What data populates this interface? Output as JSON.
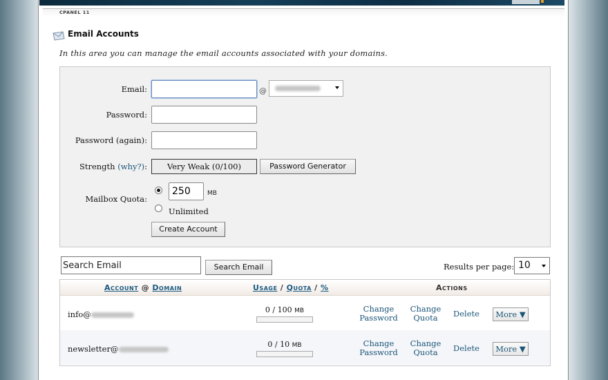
{
  "header": {
    "brand_label": "CPANEL 11",
    "title": "Email Accounts",
    "description": "In this area you can manage the email accounts associated with your domains."
  },
  "form": {
    "email_label": "Email:",
    "email_value": "",
    "at_sign": "@",
    "domain_value": "",
    "password_label": "Password:",
    "password_again_label": "Password (again):",
    "strength_label": "Strength",
    "strength_why": "(why?)",
    "strength_colon": ":",
    "strength_value": "Very Weak (0/100)",
    "password_generator_label": "Password Generator",
    "quota_label": "Mailbox Quota:",
    "quota_value": "250",
    "quota_unit": "MB",
    "unlimited_label": "Unlimited",
    "quota_selected": "limited",
    "create_label": "Create Account"
  },
  "search": {
    "value": "Search Email",
    "button_label": "Search Email",
    "results_per_page_label": "Results per page:",
    "results_per_page_value": "10"
  },
  "table": {
    "headers": {
      "account": "Account",
      "at": "@",
      "domain": "Domain",
      "usage": "Usage",
      "slash1": "/",
      "quota": "Quota",
      "slash2": "/",
      "percent": "%",
      "actions": "Actions"
    },
    "rows": [
      {
        "account": "info@",
        "usage": "0 / 100",
        "usage_unit": "MB",
        "usage_fraction": 0,
        "change_password": [
          "Change",
          "Password"
        ],
        "change_quota": [
          "Change",
          "Quota"
        ],
        "delete": "Delete",
        "more": "More ▼"
      },
      {
        "account": "newsletter@",
        "usage": "0 / 10",
        "usage_unit": "MB",
        "usage_fraction": 0,
        "change_password": [
          "Change",
          "Password"
        ],
        "change_quota": [
          "Change",
          "Quota"
        ],
        "delete": "Delete",
        "more": "More ▼"
      }
    ]
  }
}
